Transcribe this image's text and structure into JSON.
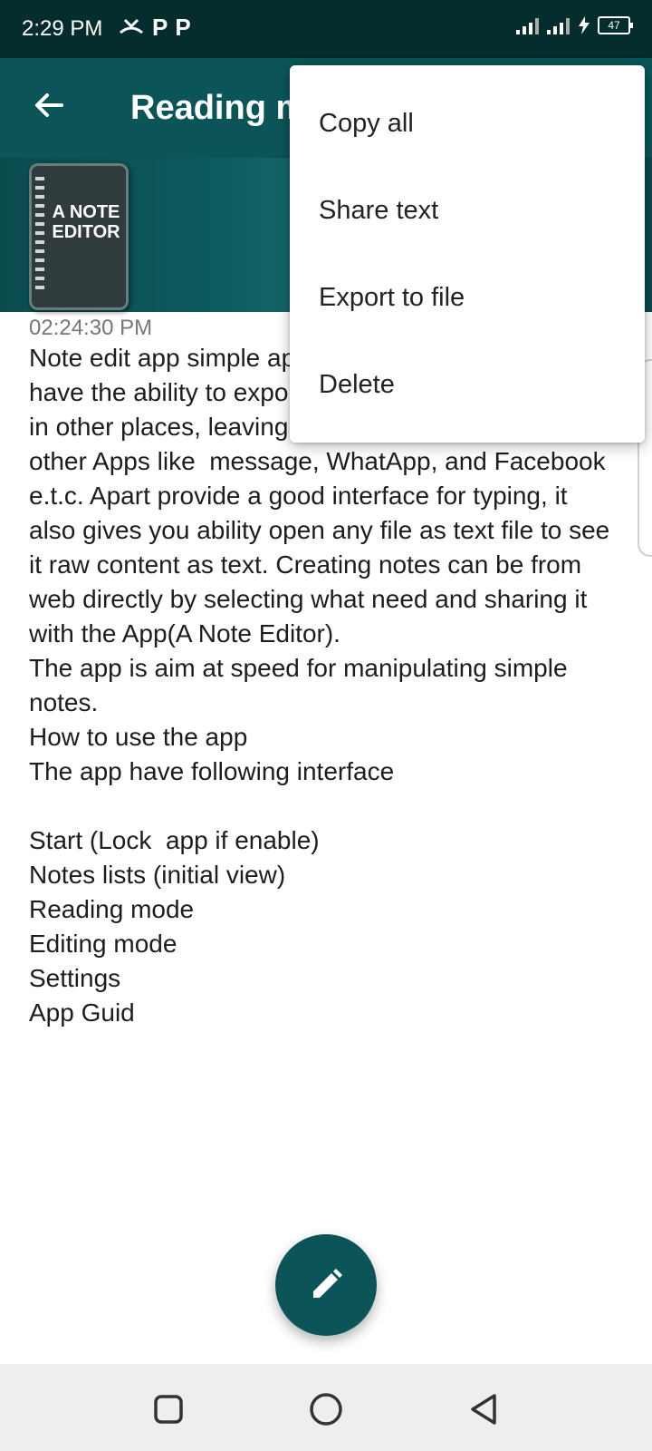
{
  "status_bar": {
    "time": "2:29 PM",
    "left_icons": [
      "missed-call-icon",
      "p-icon",
      "p-icon"
    ],
    "notification_letters": [
      "P",
      "P"
    ],
    "battery": "47"
  },
  "app_bar": {
    "back_icon": "back-arrow-icon",
    "title": "Reading mode"
  },
  "banner": {
    "logo_text": "A NOTE EDITOR"
  },
  "note": {
    "timestamp": "02:24:30 PM",
    "body": "Note edit app simple app for taking text notes. It have the ability to export your text to file to be used in other places, leaving out ability to share with other Apps like  message, WhatApp, and Facebook e.t.c. Apart provide a good interface for typing, it also gives you ability open any file as text file to see it raw content as text. Creating notes can be from web directly by selecting what need and sharing it with the App(A Note Editor).\nThe app is aim at speed for manipulating simple notes.\nHow to use the app\nThe app have following interface\n\nStart (Lock  app if enable)\nNotes lists (initial view)\nReading mode\nEditing mode\nSettings\nApp Guid"
  },
  "menu": {
    "items": [
      {
        "label": "Copy all"
      },
      {
        "label": "Share text"
      },
      {
        "label": "Export to file"
      },
      {
        "label": "Delete"
      }
    ]
  },
  "fab": {
    "icon": "pencil-icon"
  },
  "nav_bar": {
    "icons": [
      "recents-square-icon",
      "home-circle-icon",
      "back-triangle-icon"
    ]
  },
  "colors": {
    "status_bar": "#062d2e",
    "app_bar": "#0b5558",
    "fab": "#0b5558"
  }
}
